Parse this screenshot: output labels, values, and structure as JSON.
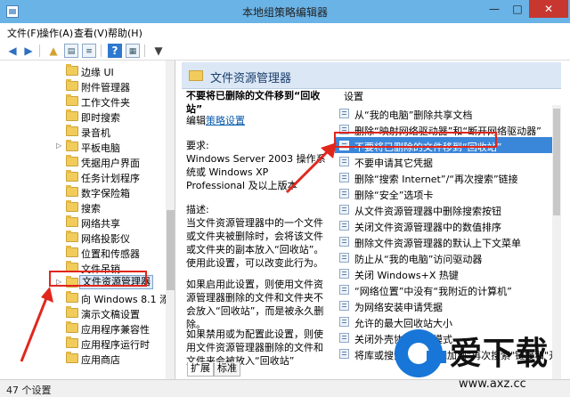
{
  "window": {
    "title": "本地组策略编辑器",
    "min_glyph": "—",
    "max_glyph": "□",
    "close_glyph": "✕"
  },
  "menu": [
    "文件(F)",
    "操作(A)",
    "查看(V)",
    "帮助(H)"
  ],
  "tree": {
    "items": [
      {
        "label": "边缘 UI"
      },
      {
        "label": "附件管理器"
      },
      {
        "label": "工作文件夹"
      },
      {
        "label": "即时搜索"
      },
      {
        "label": "录音机"
      },
      {
        "label": "平板电脑"
      },
      {
        "label": "凭据用户界面"
      },
      {
        "label": "任务计划程序"
      },
      {
        "label": "数字保险箱"
      },
      {
        "label": "搜索"
      },
      {
        "label": "网络共享"
      },
      {
        "label": "网络投影仪"
      },
      {
        "label": "位置和传感器"
      },
      {
        "label": "文件吊销"
      },
      {
        "label": "文件资源管理器"
      },
      {
        "label": "向 Windows 8.1 添加"
      },
      {
        "label": "演示文稿设置"
      },
      {
        "label": "应用程序兼容性"
      },
      {
        "label": "应用程序运行时"
      },
      {
        "label": "应用商店"
      }
    ],
    "selected_index": 14
  },
  "panel": {
    "title": "文件资源管理器",
    "policy_title": "不要将已删除的文件移到“回收站”",
    "edit_prefix": "编辑",
    "edit_link": "策略设置",
    "requirements_label": "要求:",
    "requirements_text": "Windows Server 2003 操作系统或 Windows XP Professional 及以上版本",
    "description_label": "描述:",
    "description_text": "当文件资源管理器中的一个文件或文件夹被删除时，会将该文件或文件夹的副本放入“回收站”。使用此设置，可以改变此行为。",
    "if_enabled_text": "如果启用此设置，则使用文件资源管理器删除的文件和文件夹不会放入“回收站”，而是被永久删除。",
    "if_disabled_text": "如果禁用或为配置此设置，则使用文件资源管理器删除的文件和文件夹会被放入“回收站”"
  },
  "settings": {
    "column_header": "设置",
    "items": [
      "从“我的电脑”删除共享文档",
      "删除“映射网络驱动器”和“断开网络驱动器”",
      "不要将已删除的文件移到“回收站”",
      "不要申请其它凭据",
      "删除“搜索 Internet”/“再次搜索”链接",
      "删除“安全”选项卡",
      "从文件资源管理器中删除搜索按钮",
      "关闭文件资源管理器中的数值排序",
      "删除文件资源管理器的默认上下文菜单",
      "防止从“我的电脑”访问驱动器",
      "关闭 Windows+X 热键",
      "“网络位置”中没有“我附近的计算机”",
      "为网络安装申请凭据",
      "允许的最大回收站大小",
      "关闭外壳协议保护模式",
      "将库或搜索连接器\"添加到\"再次搜索\"链接和\"开始\""
    ],
    "selected_index": 2
  },
  "tabs": [
    "扩展",
    "标准"
  ],
  "status": "47 个设置",
  "watermark": {
    "brand": "爱下载",
    "url": "www.axz.cc"
  },
  "colors": {
    "titlebar": "#6ab3e6",
    "selection": "#3a86d8",
    "highlight_box": "#e1261c",
    "watermark_blue": "#1876d8"
  }
}
